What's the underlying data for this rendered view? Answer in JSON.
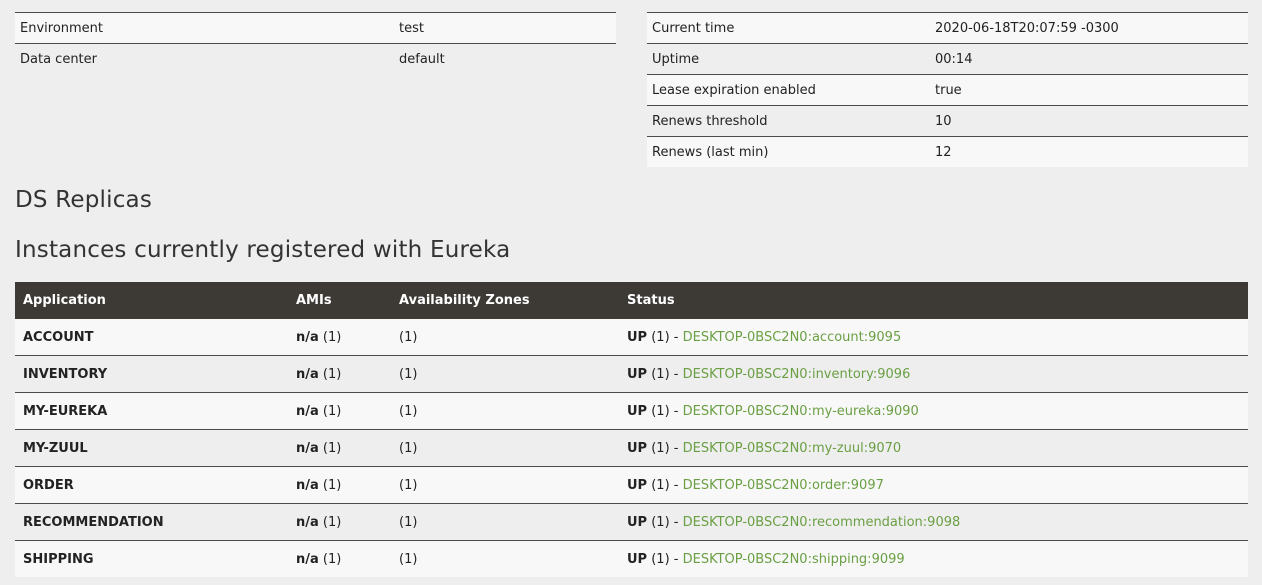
{
  "general_info": [
    {
      "key": "Environment",
      "value": "test"
    },
    {
      "key": "Data center",
      "value": "default"
    }
  ],
  "status_info": [
    {
      "key": "Current time",
      "value": "2020-06-18T20:07:59 -0300"
    },
    {
      "key": "Uptime",
      "value": "00:14"
    },
    {
      "key": "Lease expiration enabled",
      "value": "true"
    },
    {
      "key": "Renews threshold",
      "value": "10"
    },
    {
      "key": "Renews (last min)",
      "value": "12"
    }
  ],
  "headings": {
    "replicas": "DS Replicas",
    "instances": "Instances currently registered with Eureka"
  },
  "instances": {
    "columns": [
      "Application",
      "AMIs",
      "Availability Zones",
      "Status"
    ],
    "rows": [
      {
        "app": "ACCOUNT",
        "ami": "n/a",
        "ami_count": "(1)",
        "zones": "(1)",
        "status": "UP",
        "status_count": "(1) - ",
        "link": "DESKTOP-0BSC2N0:account:9095"
      },
      {
        "app": "INVENTORY",
        "ami": "n/a",
        "ami_count": "(1)",
        "zones": "(1)",
        "status": "UP",
        "status_count": "(1) - ",
        "link": "DESKTOP-0BSC2N0:inventory:9096"
      },
      {
        "app": "MY-EUREKA",
        "ami": "n/a",
        "ami_count": "(1)",
        "zones": "(1)",
        "status": "UP",
        "status_count": "(1) - ",
        "link": "DESKTOP-0BSC2N0:my-eureka:9090"
      },
      {
        "app": "MY-ZUUL",
        "ami": "n/a",
        "ami_count": "(1)",
        "zones": "(1)",
        "status": "UP",
        "status_count": "(1) - ",
        "link": "DESKTOP-0BSC2N0:my-zuul:9070"
      },
      {
        "app": "ORDER",
        "ami": "n/a",
        "ami_count": "(1)",
        "zones": "(1)",
        "status": "UP",
        "status_count": "(1) - ",
        "link": "DESKTOP-0BSC2N0:order:9097"
      },
      {
        "app": "RECOMMENDATION",
        "ami": "n/a",
        "ami_count": "(1)",
        "zones": "(1)",
        "status": "UP",
        "status_count": "(1) - ",
        "link": "DESKTOP-0BSC2N0:recommendation:9098"
      },
      {
        "app": "SHIPPING",
        "ami": "n/a",
        "ami_count": "(1)",
        "zones": "(1)",
        "status": "UP",
        "status_count": "(1) - ",
        "link": "DESKTOP-0BSC2N0:shipping:9099"
      }
    ]
  },
  "colors": {
    "header_bg": "#3d3935",
    "link": "#6a9f43",
    "page_bg": "#eeeeee",
    "row_odd": "#f8f8f8"
  }
}
